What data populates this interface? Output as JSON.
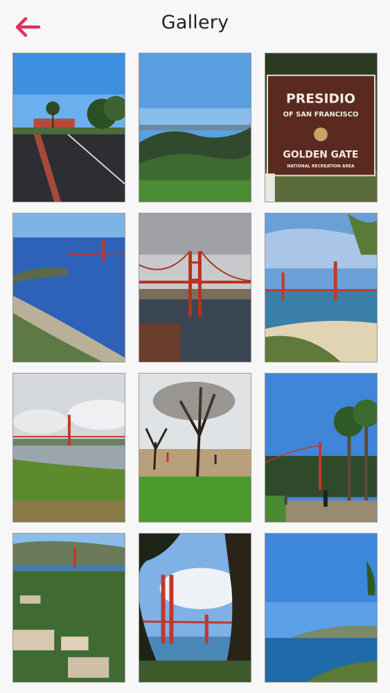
{
  "header": {
    "title": "Gallery",
    "back_icon": "arrow-left-icon",
    "accent": "#e0305a"
  },
  "sign": {
    "line1": "PRESIDIO",
    "line2": "OF SAN FRANCISCO",
    "line3": "GOLDEN GATE",
    "line4": "NATIONAL RECREATION AREA"
  },
  "gallery": {
    "columns": 3,
    "photos": [
      "street-with-palm-trees",
      "cypress-forest-bay-view",
      "presidio-golden-gate-sign",
      "aerial-bay-with-bridge",
      "bridge-in-fog",
      "bridge-from-beach",
      "bridge-over-marsh",
      "park-with-bare-trees",
      "palm-path-with-joggers",
      "aerial-presidio-buildings",
      "bridge-through-trees",
      "ocean-and-headlands"
    ]
  }
}
